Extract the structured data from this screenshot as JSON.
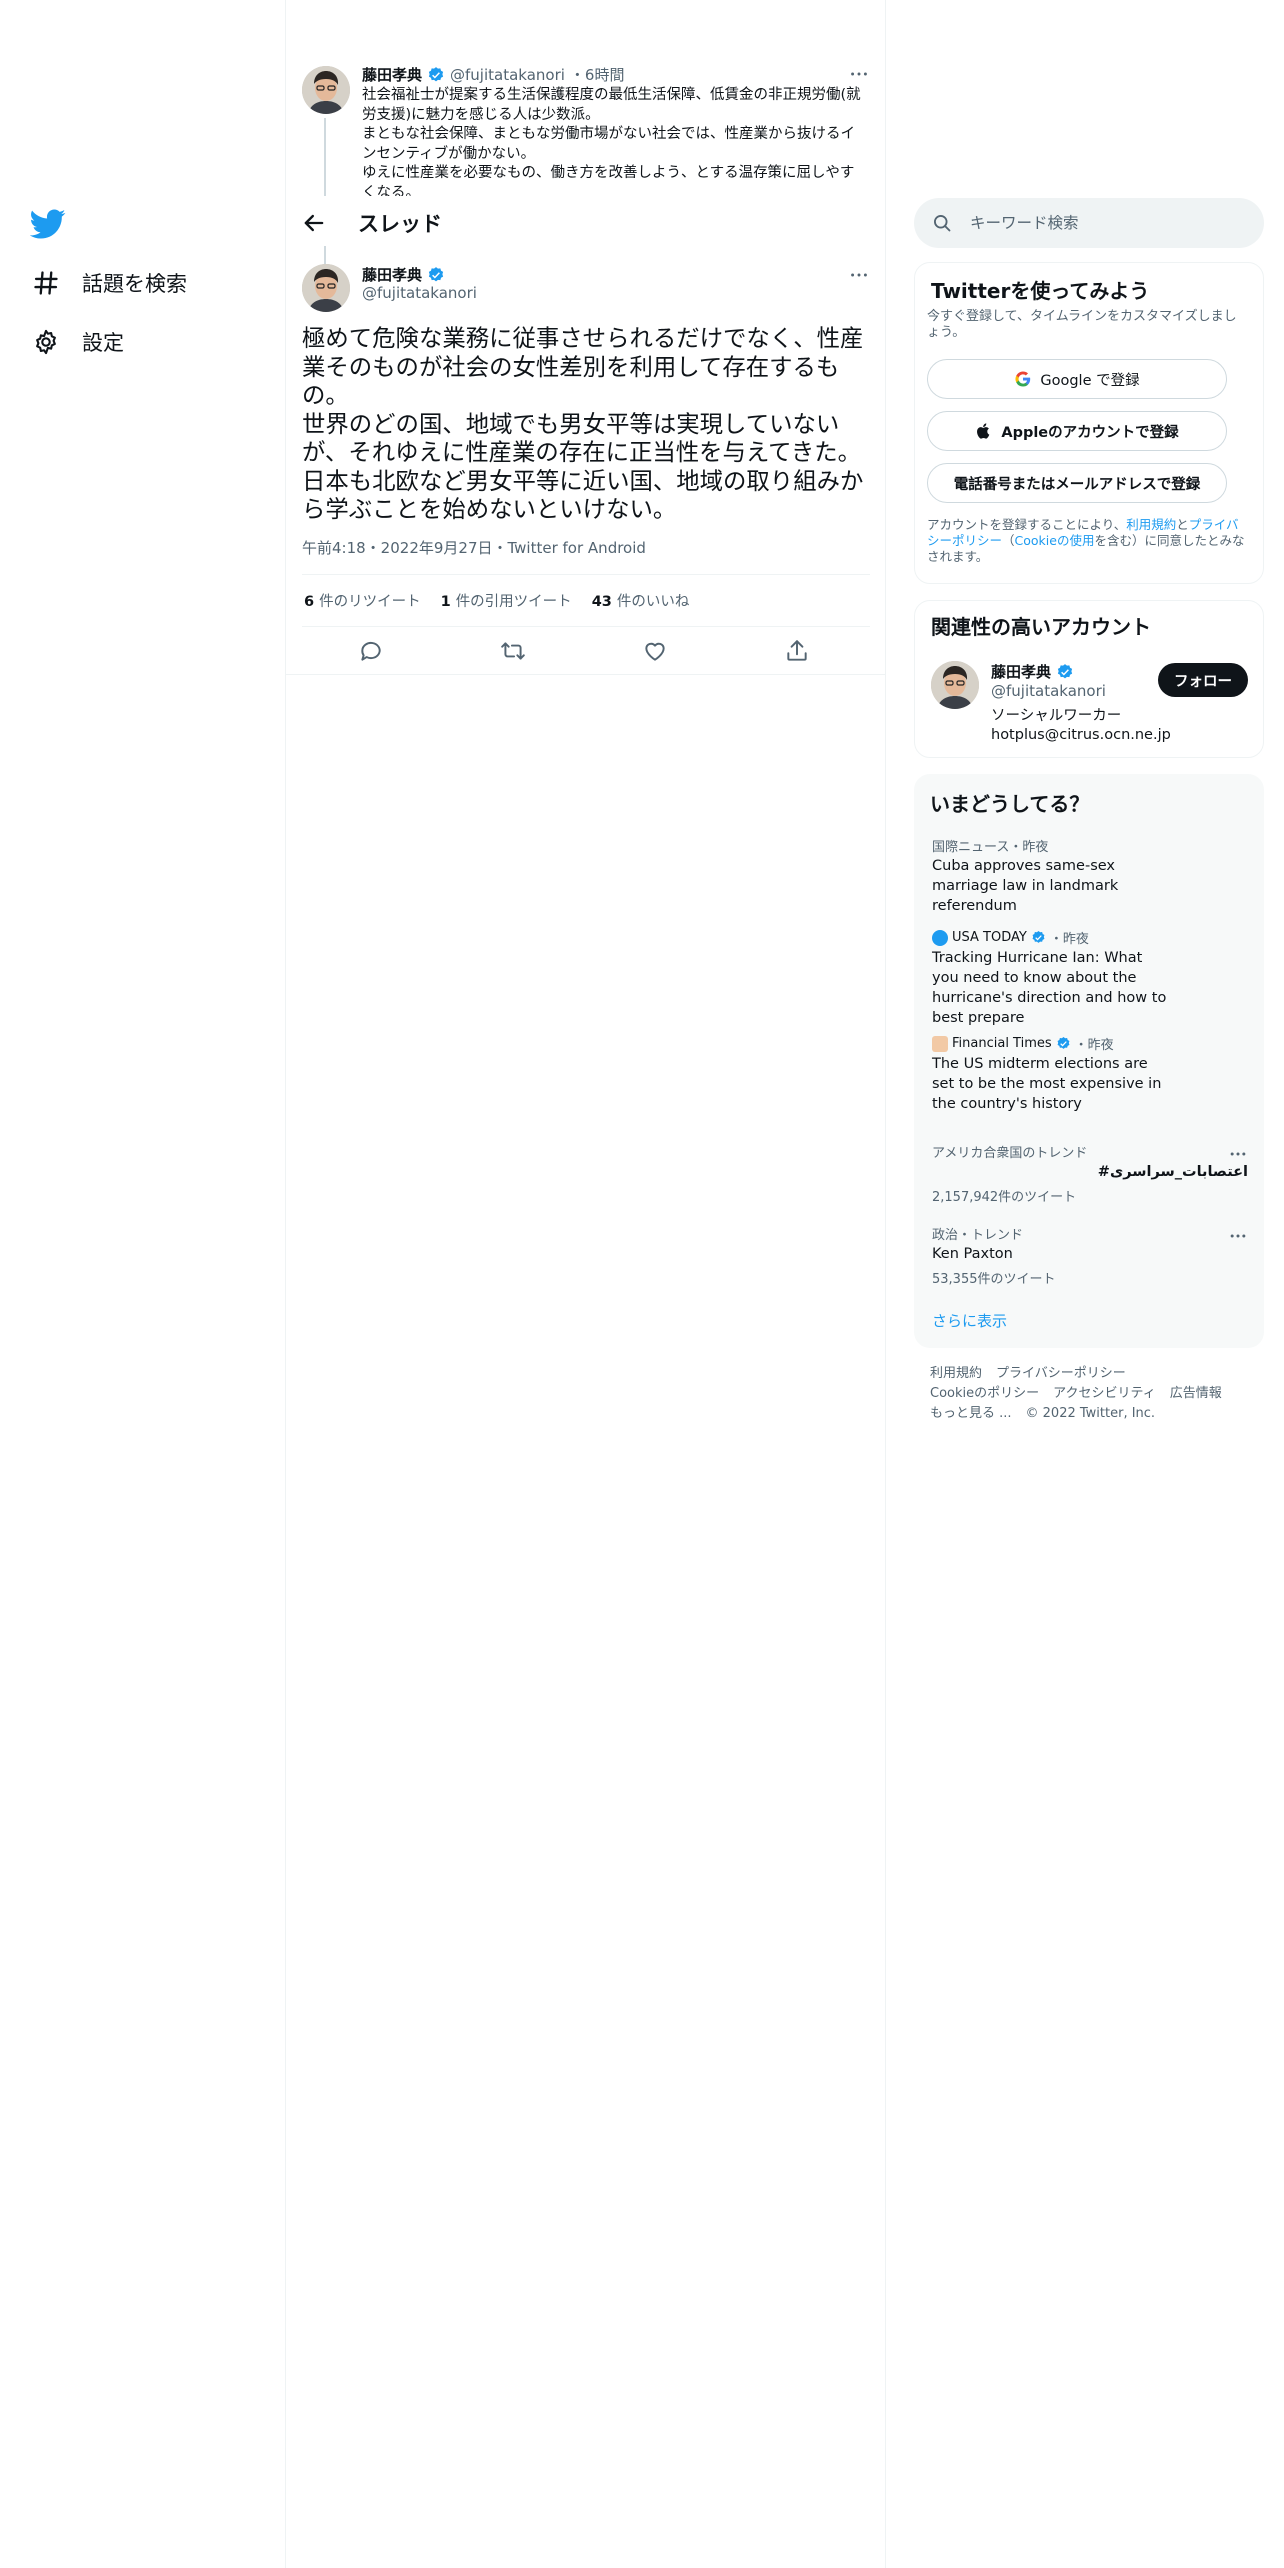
{
  "nav": {
    "explore_label": "話題を検索",
    "settings_label": "設定"
  },
  "parent_tweet": {
    "name": "藤田孝典",
    "handle": "@fujitatakanori",
    "time": "・6時間",
    "lines": [
      "社会福祉士が提案する生活保護程度の最低生活保障、低賃金の非正規労働(就労支援)に魅力を感じる人は少数派。",
      "まともな社会保障、まともな労働市場がない社会では、性産業から抜けるインセンティブが働かない。",
      "ゆえに性産業を必要なもの、働き方を改善しよう、とする温存策に屈しやすくなる。"
    ]
  },
  "thread_header": {
    "title": "スレッド"
  },
  "main_tweet": {
    "name": "藤田孝典",
    "handle": "@fujitatakanori",
    "paragraphs": [
      "極めて危険な業務に従事させられるだけでなく、性産業そのものが社会の女性差別を利用して存在するもの。",
      "世界のどの国、地域でも男女平等は実現していないが、それゆえに性産業の存在に正当性を与えてきた。",
      "日本も北欧など男女平等に近い国、地域の取り組みから学ぶことを始めないといけない。"
    ],
    "meta": "午前4:18・2022年9月27日・Twitter for Android",
    "stats": {
      "retweets_count": "6",
      "retweets_label": "件のリツイート",
      "quotes_count": "1",
      "quotes_label": "件の引用ツイート",
      "likes_count": "43",
      "likes_label": "件のいいね"
    }
  },
  "search": {
    "placeholder": "キーワード検索"
  },
  "signup": {
    "title": "Twitterを使ってみよう",
    "description": "今すぐ登録して、タイムラインをカスタマイズしましょう。",
    "google_label": "Google で登録",
    "apple_label": "Appleのアカウントで登録",
    "phone_label": "電話番号またはメールアドレスで登録",
    "legal_prefix": "アカウントを登録することにより、",
    "legal_terms": "利用規約",
    "legal_and": "と",
    "legal_privacy": "プライバシーポリシー",
    "legal_paren_open": "（",
    "legal_cookie": "Cookieの使用",
    "legal_suffix": "を含む）に同意したとみなされます。"
  },
  "relevant": {
    "title": "関連性の高いアカウント",
    "name": "藤田孝典",
    "handle": "@fujitatakanori",
    "bio_line1": "ソーシャルワーカー",
    "bio_line2": "hotplus@citrus.ocn.ne.jp",
    "follow_label": "フォロー"
  },
  "trends": {
    "title": "いまどうしてる？",
    "items": [
      {
        "category": "国際ニュース・昨夜",
        "title": "Cuba approves same-sex marriage law in landmark referendum"
      },
      {
        "source": "USA TODAY",
        "time": "・昨夜",
        "title": "Tracking Hurricane Ian: What you need to know about the hurricane's direction and how to best prepare"
      },
      {
        "source": "Financial Times",
        "time": "・昨夜",
        "title": "The US midterm elections are set to be the most expensive in the country's history"
      },
      {
        "category": "アメリカ合衆国のトレンド",
        "title": "#اعتصابات_سراسری",
        "count": "2,157,942件のツイート"
      },
      {
        "category": "政治・トレンド",
        "title": "Ken Paxton",
        "count": "53,355件のツイート"
      }
    ],
    "show_more": "さらに表示"
  },
  "footer": {
    "links": [
      "利用規約",
      "プライバシーポリシー",
      "Cookieのポリシー",
      "アクセシビリティ",
      "広告情報",
      "もっと見る ..."
    ],
    "copyright": "© 2022 Twitter, Inc."
  },
  "colors": {
    "accent": "#1d9bf0",
    "text": "#0f1419",
    "muted": "#536471",
    "border": "#eff3f4"
  }
}
